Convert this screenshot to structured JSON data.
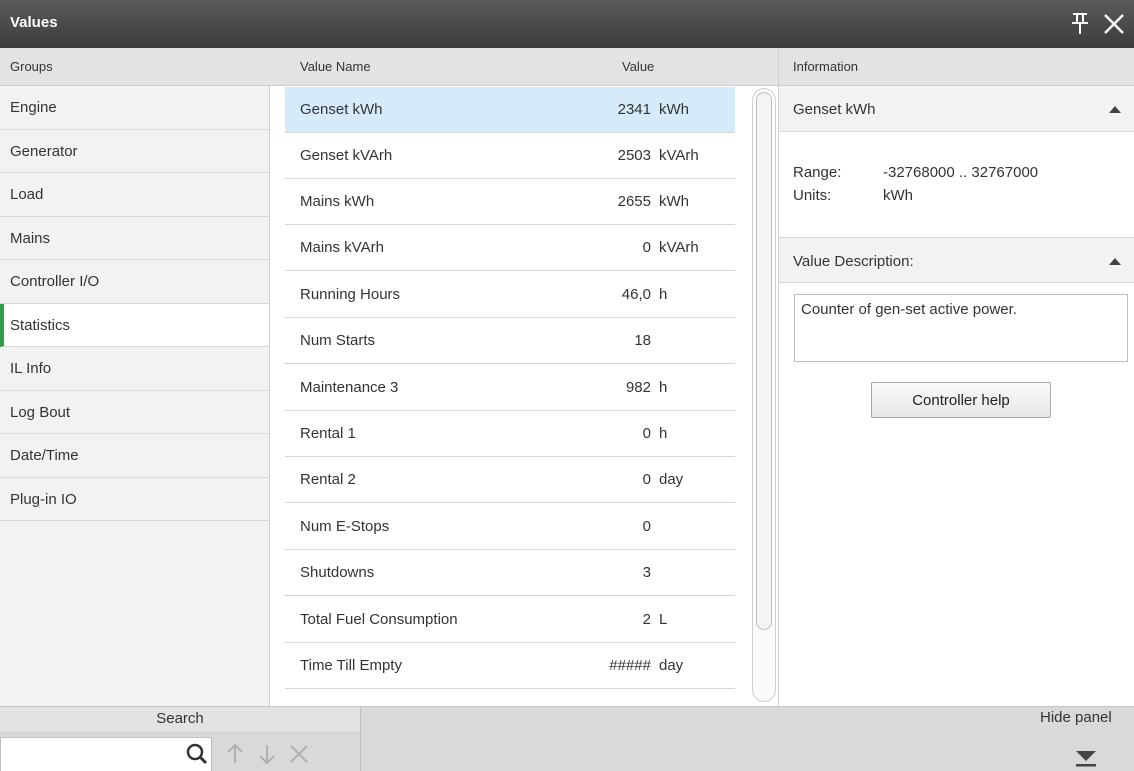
{
  "window": {
    "title": "Values"
  },
  "columns": {
    "groups": "Groups",
    "value_name": "Value Name",
    "value": "Value",
    "information": "Information"
  },
  "groups": [
    {
      "label": "Engine"
    },
    {
      "label": "Generator"
    },
    {
      "label": "Load"
    },
    {
      "label": "Mains"
    },
    {
      "label": "Controller I/O"
    },
    {
      "label": "Statistics",
      "active": true
    },
    {
      "label": "IL Info"
    },
    {
      "label": "Log Bout"
    },
    {
      "label": "Date/Time"
    },
    {
      "label": "Plug-in IO"
    }
  ],
  "values": [
    {
      "name": "Genset kWh",
      "value": "2341",
      "unit": "kWh",
      "selected": true
    },
    {
      "name": "Genset kVArh",
      "value": "2503",
      "unit": "kVArh"
    },
    {
      "name": "Mains kWh",
      "value": "2655",
      "unit": "kWh"
    },
    {
      "name": "Mains kVArh",
      "value": "0",
      "unit": "kVArh"
    },
    {
      "name": "Running Hours",
      "value": "46,0",
      "unit": "h"
    },
    {
      "name": "Num Starts",
      "value": "18",
      "unit": ""
    },
    {
      "name": "Maintenance 3",
      "value": "982",
      "unit": "h"
    },
    {
      "name": "Rental 1",
      "value": "0",
      "unit": "h"
    },
    {
      "name": "Rental 2",
      "value": "0",
      "unit": "day"
    },
    {
      "name": "Num E-Stops",
      "value": "0",
      "unit": ""
    },
    {
      "name": "Shutdowns",
      "value": "3",
      "unit": ""
    },
    {
      "name": "Total Fuel Consumption",
      "value": "2",
      "unit": "L"
    },
    {
      "name": "Time Till Empty",
      "value": "#####",
      "unit": "day"
    }
  ],
  "information": {
    "selected_title": "Genset kWh",
    "range_label": "Range:",
    "range_value": "-32768000 .. 32767000",
    "units_label": "Units:",
    "units_value": "kWh",
    "description_title": "Value Description:",
    "description": "Counter of gen-set active power.",
    "help_button": "Controller help"
  },
  "bottom": {
    "search_label": "Search",
    "search_value": "",
    "hide_panel_label": "Hide panel"
  },
  "icons": {
    "pin": "pin-icon",
    "close": "close-icon",
    "search": "search-icon",
    "up": "arrow-up-icon",
    "down": "arrow-down-icon",
    "clear": "clear-icon",
    "hide": "hide-panel-icon"
  },
  "colors": {
    "accent_active_group": "#2e9e44",
    "selected_row": "#d6ebfa",
    "titlebar": "#4a4a4a"
  }
}
